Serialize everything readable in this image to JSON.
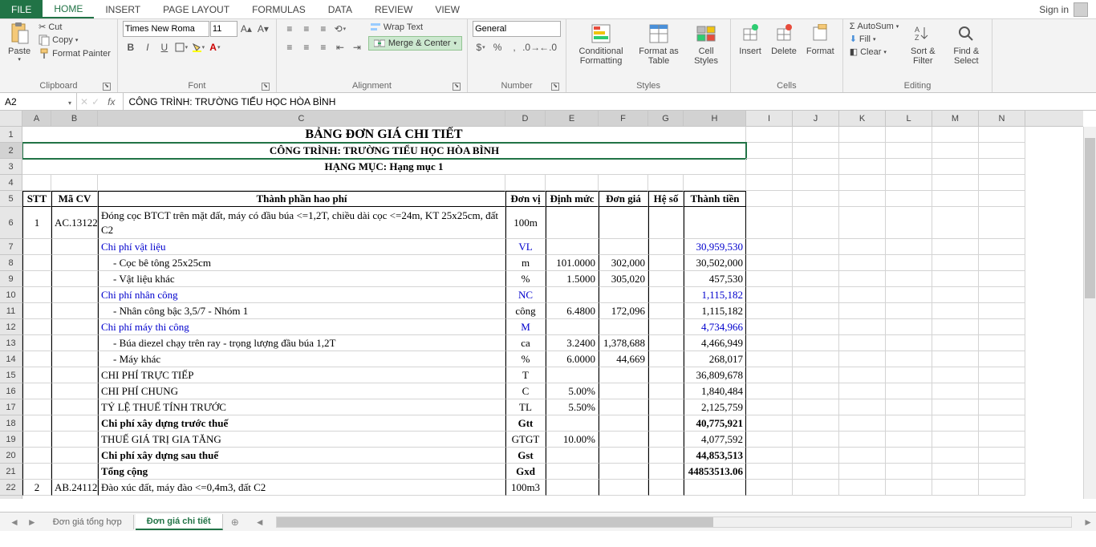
{
  "app": {
    "signin": "Sign in"
  },
  "tabs": {
    "file": "FILE",
    "home": "HOME",
    "insert": "INSERT",
    "pagelayout": "PAGE LAYOUT",
    "formulas": "FORMULAS",
    "data": "DATA",
    "review": "REVIEW",
    "view": "VIEW"
  },
  "ribbon": {
    "clipboard": {
      "paste": "Paste",
      "cut": "Cut",
      "copy": "Copy",
      "fmtpainter": "Format Painter",
      "label": "Clipboard"
    },
    "font": {
      "name": "Times New Roma",
      "size": "11",
      "label": "Font"
    },
    "alignment": {
      "wrap": "Wrap Text",
      "merge": "Merge & Center",
      "label": "Alignment"
    },
    "number": {
      "format": "General",
      "label": "Number"
    },
    "styles": {
      "cond": "Conditional Formatting",
      "table": "Format as Table",
      "cell": "Cell Styles",
      "label": "Styles"
    },
    "cells": {
      "insert": "Insert",
      "delete": "Delete",
      "format": "Format",
      "label": "Cells"
    },
    "editing": {
      "autosum": "AutoSum",
      "fill": "Fill",
      "clear": "Clear",
      "sort": "Sort & Filter",
      "find": "Find & Select",
      "label": "Editing"
    }
  },
  "formula_bar": {
    "cellref": "A2",
    "formula": "CÔNG TRÌNH: TRƯỜNG TIỂU HỌC HÒA BÌNH"
  },
  "columns": [
    "A",
    "B",
    "C",
    "D",
    "E",
    "F",
    "G",
    "H",
    "I",
    "J",
    "K",
    "L",
    "M",
    "N"
  ],
  "sheets": {
    "list": [
      "Đơn giá tổng hợp",
      "Đơn giá chi tiết"
    ],
    "active": 1
  },
  "content": {
    "r1": "BẢNG ĐƠN GIÁ CHI TIẾT",
    "r2": "CÔNG TRÌNH: TRƯỜNG TIỂU HỌC HÒA BÌNH",
    "r3": "HẠNG MỤC: Hạng mục 1",
    "hdr": {
      "stt": "STT",
      "macv": "Mã CV",
      "tp": "Thành phần hao phí",
      "dv": "Đơn vị",
      "dm": "Định mức",
      "dg": "Đơn giá",
      "hs": "Hệ số",
      "tt": "Thành tiền"
    },
    "rows": [
      {
        "n": "1",
        "cv": "AC.13122",
        "c": "Đóng cọc BTCT trên mặt đất, máy có đầu búa <=1,2T, chiều dài cọc <=24m, KT 25x25cm, đất C2",
        "d": "100m",
        "e": "",
        "f": "",
        "h": ""
      },
      {
        "c": "Chi phí vật liệu",
        "d": "VL",
        "h": "30,959,530",
        "cls": "blue"
      },
      {
        "c": " - Cọc bê tông 25x25cm",
        "d": "m",
        "e": "101.0000",
        "f": "302,000",
        "h": "30,502,000",
        "ind": 2
      },
      {
        "c": " - Vật liệu khác",
        "d": "%",
        "e": "1.5000",
        "f": "305,020",
        "h": "457,530",
        "ind": 2
      },
      {
        "c": "Chi phí nhân công",
        "d": "NC",
        "h": "1,115,182",
        "cls": "blue"
      },
      {
        "c": " - Nhân công bậc 3,5/7 - Nhóm 1",
        "d": "công",
        "e": "6.4800",
        "f": "172,096",
        "h": "1,115,182",
        "ind": 2
      },
      {
        "c": "Chi phí máy thi công",
        "d": "M",
        "h": "4,734,966",
        "cls": "blue"
      },
      {
        "c": " - Búa diezel chạy trên ray - trọng lượng đầu búa 1,2T",
        "d": "ca",
        "e": "3.2400",
        "f": "1,378,688",
        "h": "4,466,949",
        "ind": 2
      },
      {
        "c": " - Máy khác",
        "d": "%",
        "e": "6.0000",
        "f": "44,669",
        "h": "268,017",
        "ind": 2
      },
      {
        "c": "CHI PHÍ TRỰC TIẾP",
        "d": "T",
        "h": "36,809,678"
      },
      {
        "c": "CHI PHÍ CHUNG",
        "d": "C",
        "e": "5.00%",
        "h": "1,840,484"
      },
      {
        "c": "TỶ LỆ THUẾ TÍNH TRƯỚC",
        "d": "TL",
        "e": "5.50%",
        "h": "2,125,759"
      },
      {
        "c": "Chi phí xây dựng trước thuế",
        "d": "Gtt",
        "h": "40,775,921",
        "cls": "bold"
      },
      {
        "c": "THUẾ GIÁ TRỊ GIA TĂNG",
        "d": "GTGT",
        "e": "10.00%",
        "h": "4,077,592"
      },
      {
        "c": "Chi phí xây dựng sau thuế",
        "d": "Gst",
        "h": "44,853,513",
        "cls": "bold"
      },
      {
        "c": "Tổng cộng",
        "d": "Gxd",
        "h": "44853513.06",
        "cls": "bold"
      },
      {
        "n": "2",
        "cv": "AB.24112",
        "c": "Đào xúc đất, máy đào <=0,4m3, đất C2",
        "d": "100m3"
      }
    ]
  }
}
